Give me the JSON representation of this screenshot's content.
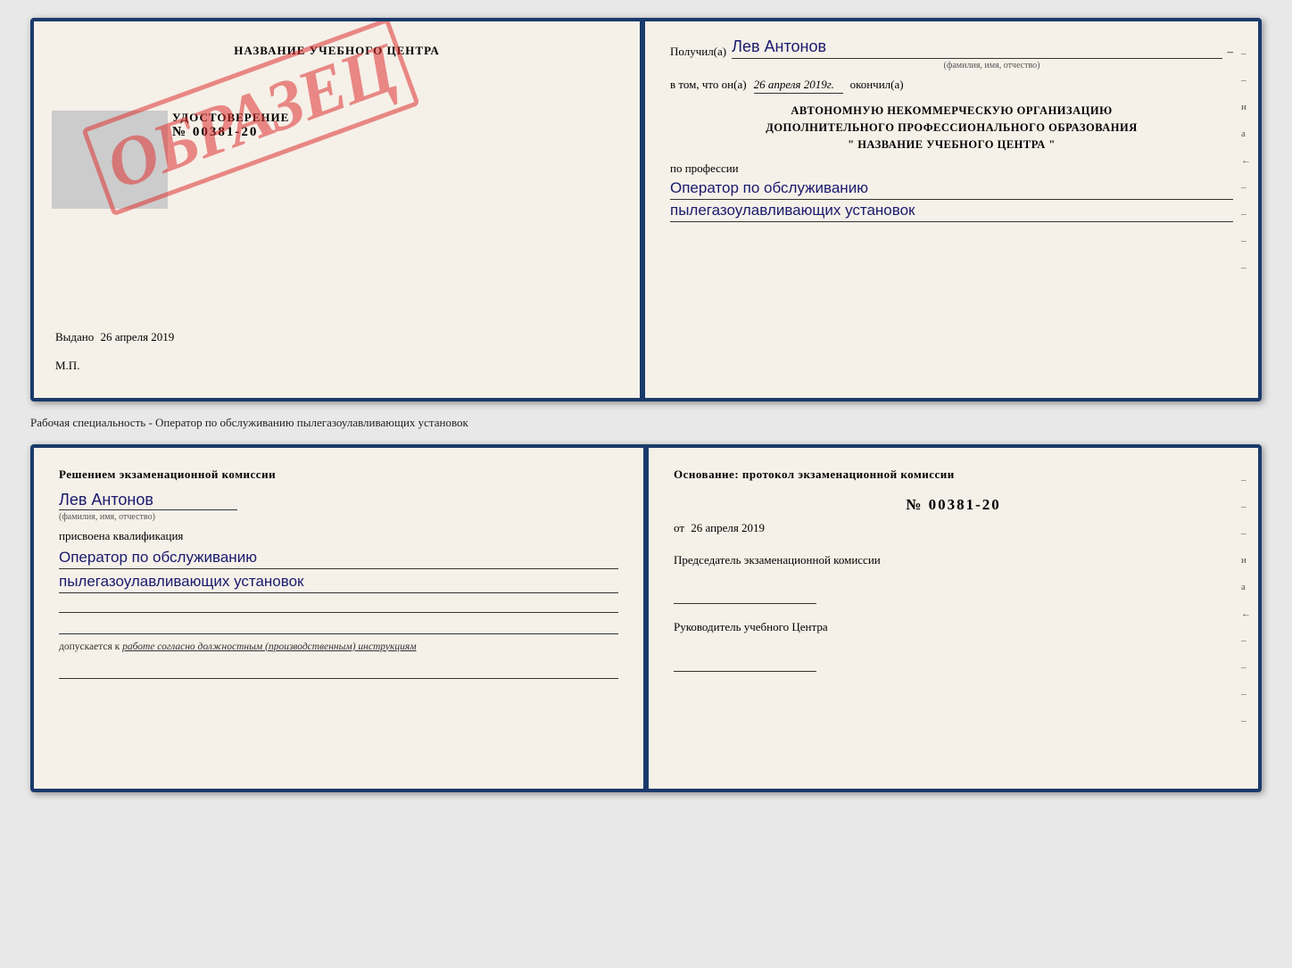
{
  "top_book": {
    "left_page": {
      "title": "НАЗВАНИЕ УЧЕБНОГО ЦЕНТРА",
      "stamp": "ОБРАЗЕЦ",
      "udostoverenie_label": "УДОСТОВЕРЕНИЕ",
      "number": "№ 00381-20",
      "vydano_label": "Выдано",
      "vydano_date": "26 апреля 2019",
      "mp_label": "М.П."
    },
    "right_page": {
      "poluchil_label": "Получил(а)",
      "poluchil_name": "Лев Антонов",
      "fio_label": "(фамилия, имя, отчество)",
      "vtom_label": "в том, что он(а)",
      "vtom_date": "26 апреля 2019г.",
      "okonchil_label": "окончил(а)",
      "org_line1": "АВТОНОМНУЮ НЕКОММЕРЧЕСКУЮ ОРГАНИЗАЦИЮ",
      "org_line2": "ДОПОЛНИТЕЛЬНОГО ПРОФЕССИОНАЛЬНОГО ОБРАЗОВАНИЯ",
      "org_line3": "\"  НАЗВАНИЕ УЧЕБНОГО ЦЕНТРА  \"",
      "po_professii_label": "по профессии",
      "professiya_line1": "Оператор по обслуживанию",
      "professiya_line2": "пылегазоулавливающих установок",
      "side_marks": [
        "–",
        "–",
        "и",
        "а",
        "←",
        "–",
        "–",
        "–",
        "–"
      ]
    }
  },
  "subtitle": "Рабочая специальность - Оператор по обслуживанию пылегазоулавливающих установок",
  "bottom_book": {
    "left_page": {
      "resheniem_label": "Решением экзаменационной комиссии",
      "person_name": "Лев Антонов",
      "fio_label": "(фамилия, имя, отчество)",
      "prisvoena_label": "присвоена квалификация",
      "kval_line1": "Оператор по обслуживанию",
      "kval_line2": "пылегазоулавливающих установок",
      "dopuskaetsya_label": "допускается к",
      "dopuskaetsya_text": "работе согласно должностным (производственным) инструкциям"
    },
    "right_page": {
      "osnovanie_label": "Основание: протокол экзаменационной комиссии",
      "number": "№  00381-20",
      "ot_label": "от",
      "ot_date": "26 апреля 2019",
      "predsedatel_label": "Председатель экзаменационной комиссии",
      "rukovoditel_label": "Руководитель учебного Центра",
      "side_marks": [
        "–",
        "–",
        "–",
        "и",
        "а",
        "←",
        "–",
        "–",
        "–",
        "–"
      ]
    }
  }
}
